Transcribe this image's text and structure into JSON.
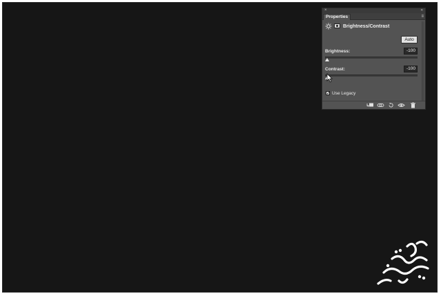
{
  "panel": {
    "tab_label": "Properties",
    "close_glyph": "×",
    "collapse_glyph": "«",
    "menu_glyph": "≡",
    "adjustment_title": "Brightness/Contrast",
    "auto_label": "Auto",
    "brightness": {
      "label": "Brightness:",
      "value": "-100",
      "slider_fraction": 0.0
    },
    "contrast": {
      "label": "Contrast:",
      "value": "-100",
      "slider_fraction": 0.0
    },
    "use_legacy": {
      "label": "Use Legacy",
      "checked": true,
      "mark": "✓"
    }
  },
  "icons": {
    "adjustment": "sun-icon",
    "mask": "layer-mask-icon",
    "bottom": [
      "clip-to-layer-icon",
      "view-previous-state-icon",
      "reset-icon",
      "visibility-icon",
      "trash-icon"
    ]
  },
  "colors": {
    "canvas": "#161616",
    "panel_bg": "#535353",
    "panel_dark": "#3f3f3f",
    "text": "#eaeaea",
    "field_bg": "#2a2a2a"
  }
}
